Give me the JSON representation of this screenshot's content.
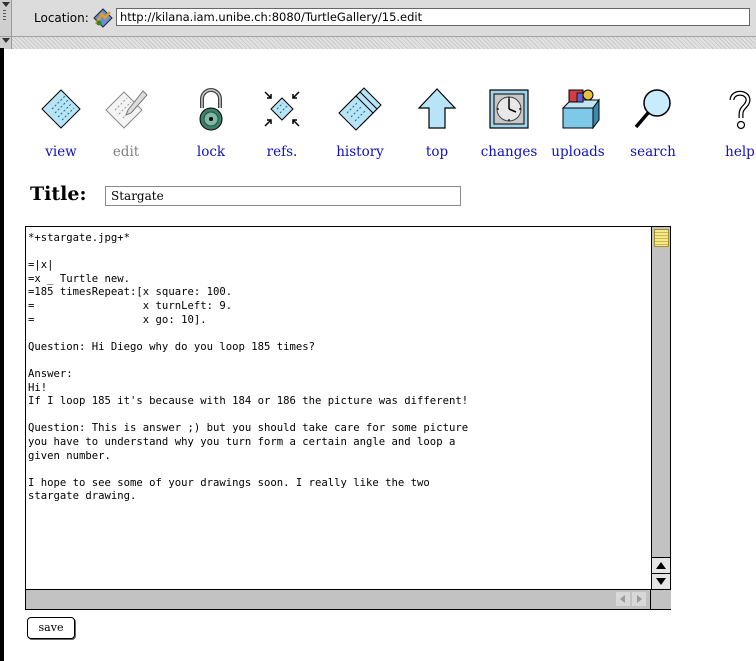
{
  "location": {
    "label": "Location:",
    "url": "http://kilana.iam.unibe.ch:8080/TurtleGallery/15.edit"
  },
  "nav": [
    {
      "label": "view",
      "icon": "view-icon",
      "enabled": true
    },
    {
      "label": "edit",
      "icon": "edit-icon",
      "enabled": false
    },
    {
      "label": "lock",
      "icon": "lock-icon",
      "enabled": true
    },
    {
      "label": "refs.",
      "icon": "refs-icon",
      "enabled": true
    },
    {
      "label": "history",
      "icon": "history-icon",
      "enabled": true
    },
    {
      "label": "top",
      "icon": "top-icon",
      "enabled": true
    },
    {
      "label": "changes",
      "icon": "changes-icon",
      "enabled": true
    },
    {
      "label": "uploads",
      "icon": "uploads-icon",
      "enabled": true
    },
    {
      "label": "search",
      "icon": "search-icon",
      "enabled": true
    },
    {
      "label": "help",
      "icon": "help-icon",
      "enabled": true
    }
  ],
  "title": {
    "label": "Title:",
    "value": "Stargate"
  },
  "editor": {
    "text": "*+stargate.jpg+*\n\n=|x|\n=x _ Turtle new.\n=185 timesRepeat:[x square: 100.\n=                 x turnLeft: 9.\n=                 x go: 10].\n\nQuestion: Hi Diego why do you loop 185 times?\n\nAnswer:\nHi!\nIf I loop 185 it's because with 184 or 186 the picture was different!\n\nQuestion: This is answer ;) but you should take care for some picture\nyou have to understand why you turn form a certain angle and loop a\ngiven number.\n\nI hope to see some of your drawings soon. I really like the two\nstargate drawing."
  },
  "save_button": {
    "label": "save"
  },
  "colors": {
    "link": "#1010c0",
    "disabled": "#808080",
    "scroll_thumb": "#f5e98a"
  }
}
